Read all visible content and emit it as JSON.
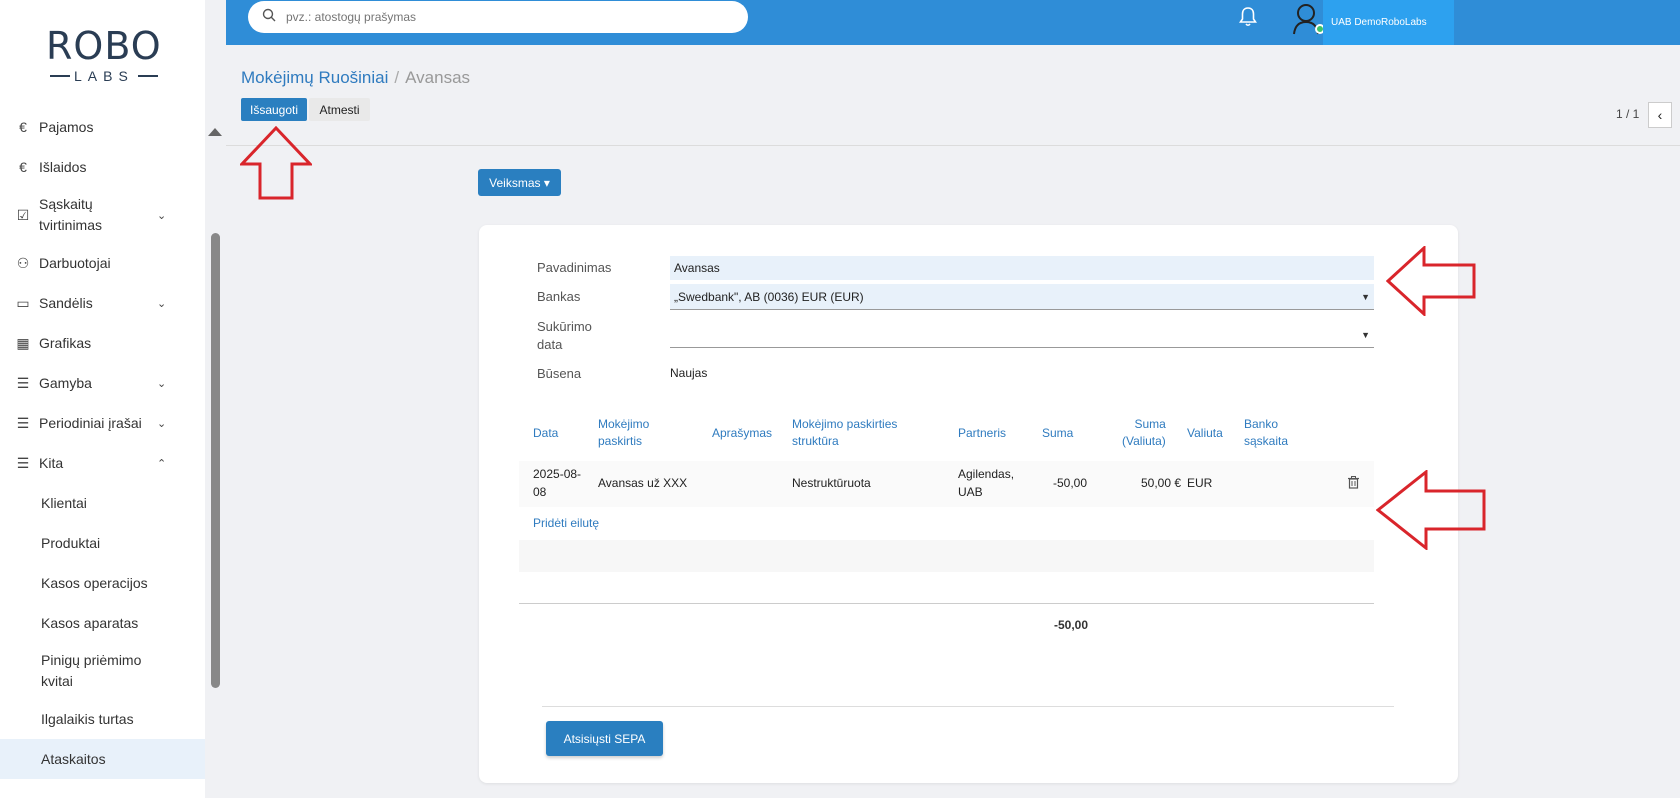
{
  "sidebar": {
    "logo_top": "ROBO",
    "logo_bottom": "LABS",
    "items": [
      {
        "label": "Pajamos",
        "icon": "euro-circle-icon"
      },
      {
        "label": "Išlaidos",
        "icon": "euro-circle-icon"
      },
      {
        "label": "Sąskaitų tvirtinimas",
        "icon": "document-check-icon"
      },
      {
        "label": "Darbuotojai",
        "icon": "users-icon"
      },
      {
        "label": "Sandėlis",
        "icon": "archive-icon"
      },
      {
        "label": "Grafikas",
        "icon": "calendar-icon"
      },
      {
        "label": "Gamyba",
        "icon": "list-icon"
      },
      {
        "label": "Periodiniai įrašai",
        "icon": "list-icon"
      },
      {
        "label": "Kita",
        "icon": "list-icon"
      }
    ],
    "sub_items": [
      "Klientai",
      "Produktai",
      "Kasos operacijos",
      "Kasos aparatas",
      "Pinigų priėmimo kvitai",
      "Ilgalaikis turtas",
      "Ataskaitos"
    ]
  },
  "topbar": {
    "search_placeholder": "pvz.: atostogų prašymas",
    "company": "UAB DemoRoboLabs"
  },
  "header": {
    "breadcrumb_parent": "Mokėjimų Ruošiniai",
    "breadcrumb_sep": "/",
    "breadcrumb_current": "Avansas",
    "save_label": "Išsaugoti",
    "discard_label": "Atmesti",
    "pager": "1 / 1",
    "action_label": "Veiksmas ▾"
  },
  "form": {
    "name_label": "Pavadinimas",
    "name_value": "Avansas",
    "bank_label": "Bankas",
    "bank_value": "„Swedbank\", AB (0036) EUR (EUR)",
    "date_label_1": "Sukūrimo",
    "date_label_2": "data",
    "date_value": "",
    "status_label": "Būsena",
    "status_value": "Naujas"
  },
  "table": {
    "headers": {
      "date": "Data",
      "purpose_1": "Mokėjimo",
      "purpose_2": "paskirtis",
      "description": "Aprašymas",
      "structure_1": "Mokėjimo paskirties",
      "structure_2": "struktūra",
      "partner": "Partneris",
      "amount": "Suma",
      "amount_cur_1": "Suma",
      "amount_cur_2": "(Valiuta)",
      "currency": "Valiuta",
      "bank_acc_1": "Banko",
      "bank_acc_2": "sąskaita"
    },
    "rows": [
      {
        "date_1": "2025-08-",
        "date_2": "08",
        "purpose": "Avansas už XXX",
        "description": "",
        "structure": "Nestruktūruota",
        "partner_1": "Agilendas,",
        "partner_2": "UAB",
        "amount": "-50,00",
        "amount_cur": "50,00 €",
        "currency": "EUR",
        "bank_acc": ""
      }
    ],
    "add_line": "Pridėti eilutę",
    "total": "-50,00"
  },
  "footer": {
    "sepa_label": "Atsisiųsti SEPA"
  },
  "colors": {
    "topbar": "#2f8dd7",
    "primary_button": "#2a7fc0",
    "annotation_arrow": "#d9252b"
  }
}
